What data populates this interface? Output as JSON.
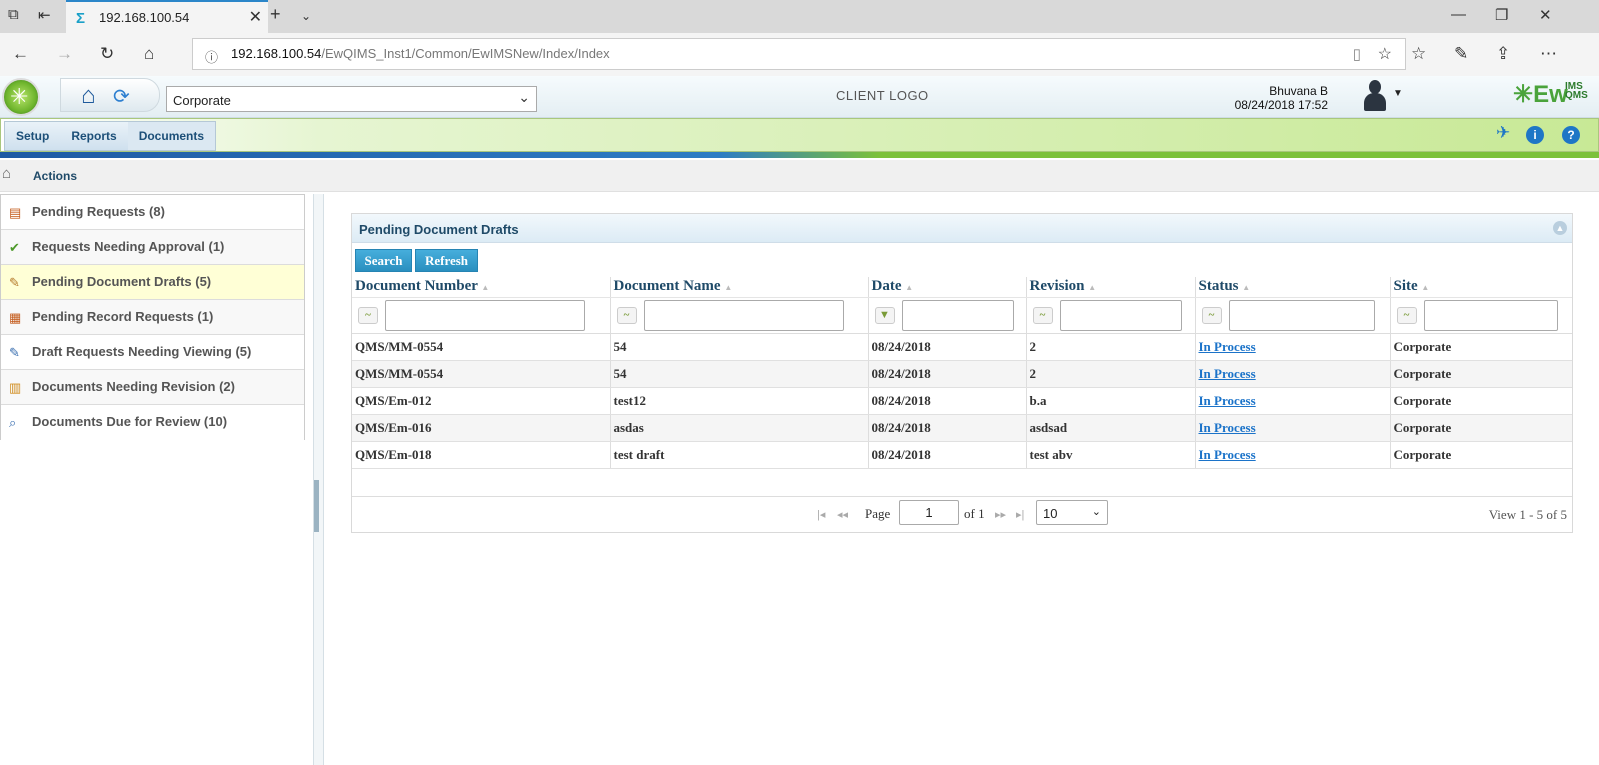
{
  "browser": {
    "tab_title": "192.168.100.54",
    "url_host": "192.168.100.54",
    "url_path": "/EwQIMS_Inst1/Common/EwIMSNew/Index/Index"
  },
  "header": {
    "site_select": "Corporate",
    "client_logo": "CLIENT LOGO",
    "user_name": "Bhuvana B",
    "user_datetime": "08/24/2018 17:52",
    "brand": "Ew",
    "brand_sub": "IMS QMS"
  },
  "menu": {
    "items": [
      "Setup",
      "Reports",
      "Documents"
    ]
  },
  "breadcrumb": {
    "title": "Actions"
  },
  "sidebar": {
    "items": [
      {
        "label": "Pending Requests (8)"
      },
      {
        "label": "Requests Needing Approval (1)"
      },
      {
        "label": "Pending Document Drafts (5)"
      },
      {
        "label": "Pending Record Requests (1)"
      },
      {
        "label": "Draft Requests Needing Viewing (5)"
      },
      {
        "label": "Documents Needing Revision (2)"
      },
      {
        "label": "Documents Due for Review (10)"
      }
    ]
  },
  "panel": {
    "title": "Pending Document Drafts",
    "search_label": "Search",
    "refresh_label": "Refresh",
    "columns": [
      "Document Number",
      "Document Name",
      "Date",
      "Revision",
      "Status",
      "Site"
    ],
    "rows": [
      {
        "doc_number": "QMS/MM-0554",
        "doc_name": "54",
        "date": "08/24/2018",
        "revision": "2",
        "status": "In Process",
        "site": "Corporate"
      },
      {
        "doc_number": "QMS/MM-0554",
        "doc_name": "54",
        "date": "08/24/2018",
        "revision": "2",
        "status": "In Process",
        "site": "Corporate"
      },
      {
        "doc_number": "QMS/Em-012",
        "doc_name": "test12",
        "date": "08/24/2018",
        "revision": "b.a",
        "status": "In Process",
        "site": "Corporate"
      },
      {
        "doc_number": "QMS/Em-016",
        "doc_name": "asdas",
        "date": "08/24/2018",
        "revision": "asdsad",
        "status": "In Process",
        "site": "Corporate"
      },
      {
        "doc_number": "QMS/Em-018",
        "doc_name": "test draft",
        "date": "08/24/2018",
        "revision": "test abv",
        "status": "In Process",
        "site": "Corporate"
      }
    ]
  },
  "pager": {
    "page_label": "Page",
    "page_value": "1",
    "of_label": "of 1",
    "per_page": "10",
    "view_info": "View 1 - 5 of 5"
  }
}
